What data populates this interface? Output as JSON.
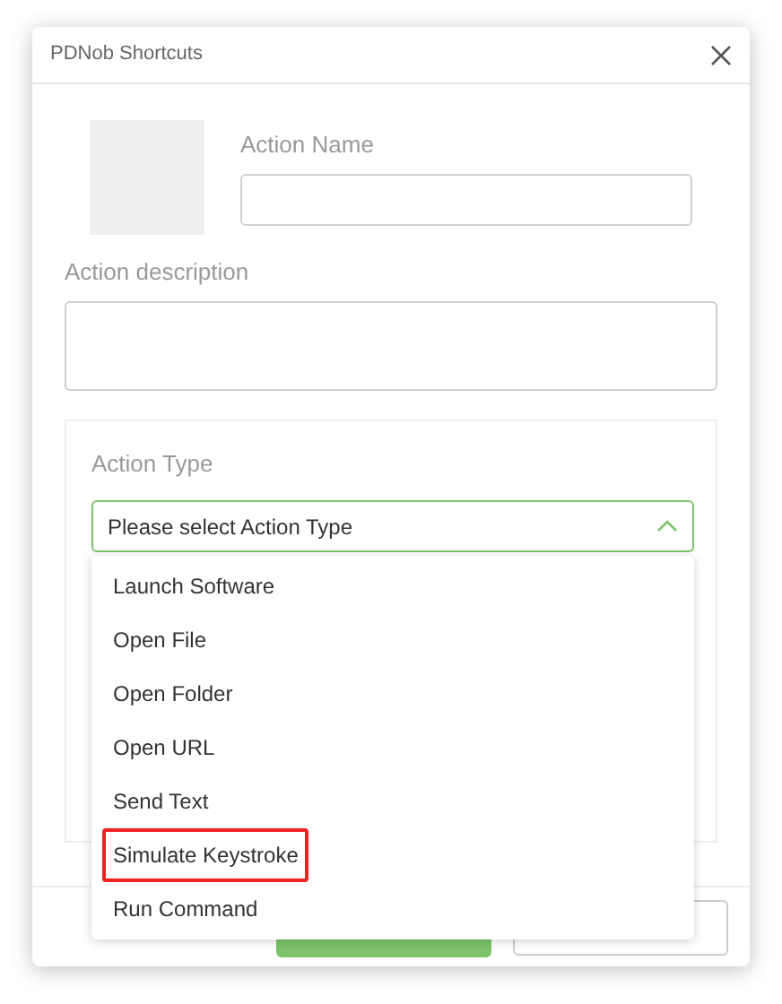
{
  "window": {
    "title": "PDNob Shortcuts"
  },
  "action_name": {
    "label": "Action Name"
  },
  "action_description": {
    "label": "Action description"
  },
  "action_type": {
    "label": "Action Type",
    "placeholder": "Please select Action Type",
    "expanded": true,
    "options": [
      {
        "label": "Launch Software",
        "highlighted": false
      },
      {
        "label": "Open File",
        "highlighted": false
      },
      {
        "label": "Open Folder",
        "highlighted": false
      },
      {
        "label": "Open URL",
        "highlighted": false
      },
      {
        "label": "Send Text",
        "highlighted": false
      },
      {
        "label": "Simulate Keystroke",
        "highlighted": true
      },
      {
        "label": "Run Command",
        "highlighted": false
      }
    ]
  }
}
